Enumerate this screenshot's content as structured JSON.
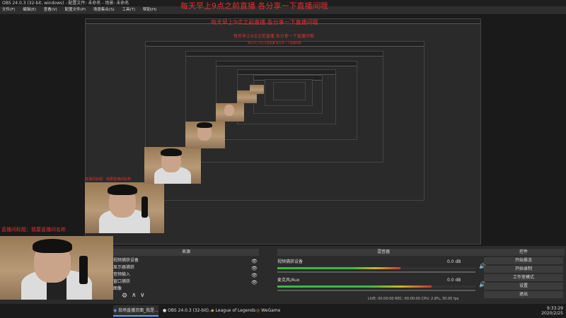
{
  "window": {
    "title": "OBS 24.0.3 (32-bit, windows) - 配置文件: 未命名 - 场景: 未命名"
  },
  "menu": [
    "文件(F)",
    "编辑(E)",
    "查看(V)",
    "配置文件(P)",
    "场景集合(S)",
    "工具(T)",
    "帮助(H)"
  ],
  "banner": {
    "text": "每天早上9点之前直播   各分享一下直播间哦"
  },
  "overlay_text": "直播间标题：我要直播间名称",
  "panels": {
    "sources": {
      "title": "来源",
      "items": [
        "视频捕获设备",
        "显示器捕获",
        "音频输入",
        "窗口捕获",
        "图像"
      ]
    },
    "mixer": {
      "title": "混音器",
      "tracks": [
        {
          "name": "视频捕获设备",
          "db": "0.0 dB",
          "level": 0.62
        },
        {
          "name": "麦克风/Aux",
          "db": "0.0 dB",
          "level": 0.78
        }
      ]
    },
    "controls": {
      "title": "控件",
      "buttons": [
        "开始推流",
        "开始录制",
        "工作室模式",
        "设置",
        "退出"
      ]
    },
    "status": "LIVE: 00:00:00   REC: 00:00:00   CPU: 2.8%, 30.00 fps"
  },
  "taskbar": {
    "items": [
      {
        "label": "现场直播页面_我是..."
      },
      {
        "label": "OBS 24.0.3 (32-bit)..."
      },
      {
        "label": "League of Legends"
      },
      {
        "label": "WeGame"
      }
    ],
    "time": "9:33:29",
    "date": "2020/2/25"
  },
  "colors": {
    "accent": "#e03030",
    "meter_green": "#3fb83f",
    "meter_yellow": "#c9b52a",
    "meter_red": "#c53a2e"
  }
}
